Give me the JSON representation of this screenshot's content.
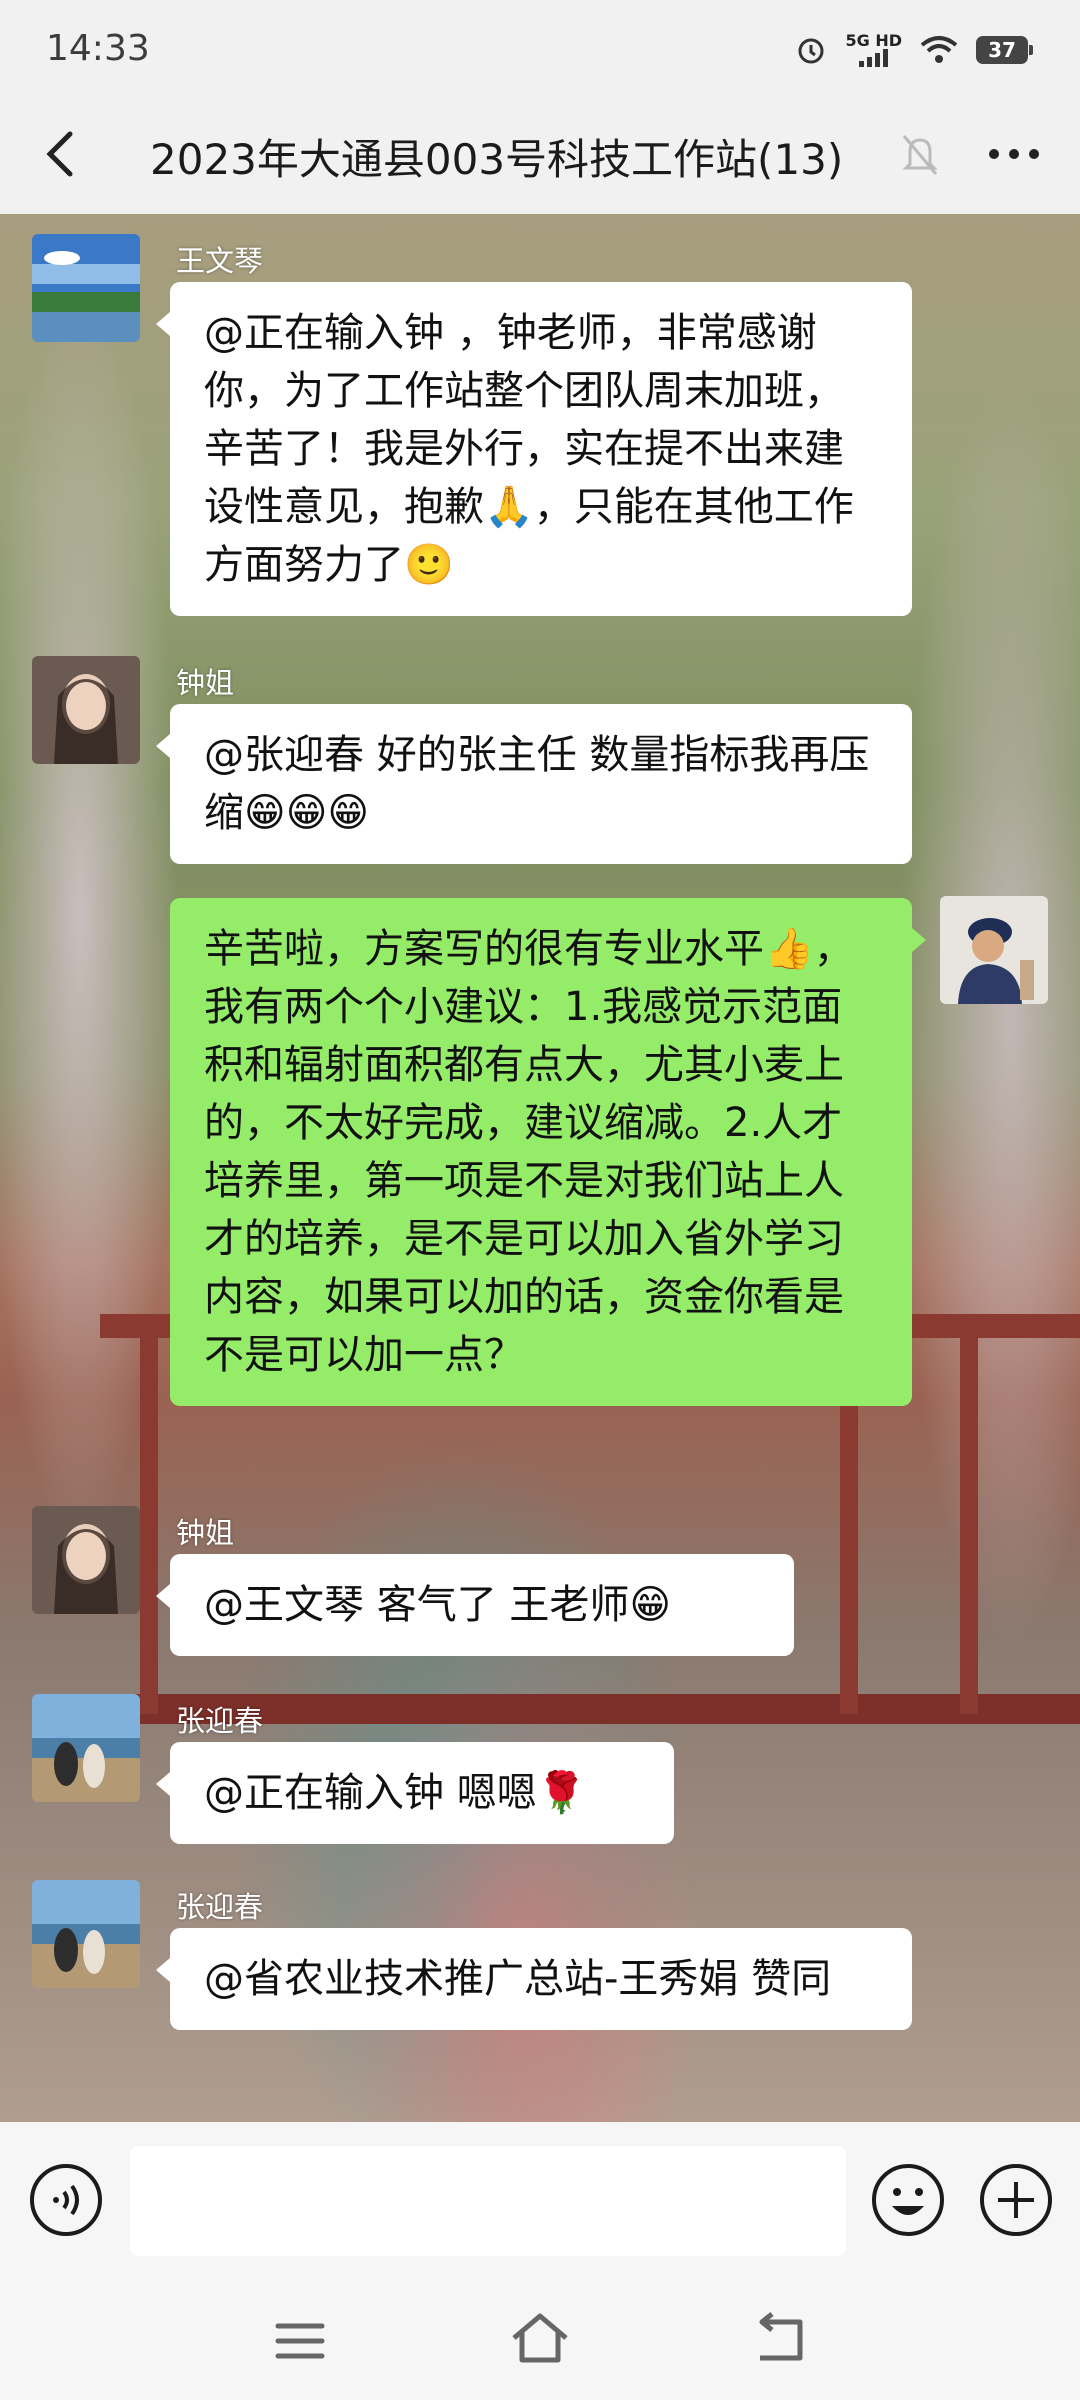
{
  "status_bar": {
    "time": "14:33",
    "network": "5G HD",
    "battery": "37"
  },
  "header": {
    "title": "2023年大通县003号科技工作站(13)"
  },
  "messages": [
    {
      "sender": "王文琴",
      "text": "@正在输入钟 ，钟老师，非常感谢你，为了工作站整个团队周末加班，辛苦了！我是外行，实在提不出来建设性意见，抱歉🙏，只能在其他工作方面努力了🙂"
    },
    {
      "sender": "钟姐",
      "text": "@张迎春  好的张主任   数量指标我再压缩😁😁😁"
    },
    {
      "sender": "",
      "text": "辛苦啦，方案写的很有专业水平👍，我有两个个小建议：1.我感觉示范面积和辐射面积都有点大，尤其小麦上的，不太好完成，建议缩减。2.人才培养里，第一项是不是对我们站上人才的培养，是不是可以加入省外学习内容，如果可以加的话，资金你看是不是可以加一点？"
    },
    {
      "sender": "钟姐",
      "text": "@王文琴  客气了  王老师😁"
    },
    {
      "sender": "张迎春",
      "text": "@正在输入钟  嗯嗯🌹"
    },
    {
      "sender": "张迎春",
      "text": "@省农业技术推广总站-王秀娟  赞同"
    }
  ],
  "input": {
    "placeholder": ""
  },
  "colors": {
    "outgoing_bubble": "#95ec69",
    "incoming_bubble": "#ffffff",
    "bar_bg": "#f6f6f6"
  }
}
